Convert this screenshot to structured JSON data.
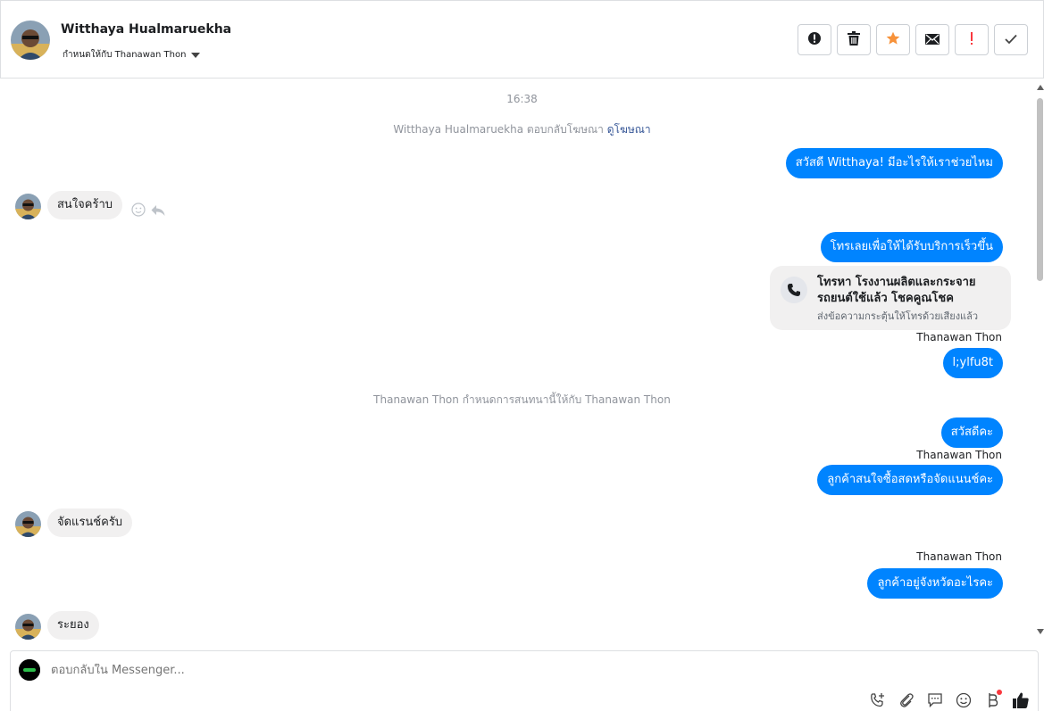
{
  "header": {
    "name": "Witthaya Hualmaruekha",
    "assigned_label": "กำหนดให้กับ Thanawan Thon",
    "actions": [
      "spam-icon",
      "trash-icon",
      "star-icon",
      "mark-unread-icon",
      "follow-up-icon",
      "done-icon"
    ],
    "star_color": "#f7923a",
    "followup_color": "#fa383e"
  },
  "chat": {
    "timestamp": "16:38",
    "ad_reply_text": "Witthaya Hualmaruekha ตอบกลับโฆษณา",
    "ad_reply_link": "ดูโฆษณา",
    "messages": {
      "m1": "สวัสดี Witthaya! มีอะไรให้เราช่วยไหม",
      "m2": "สนใจคร้าบ",
      "m3": "โทรเลยเพื่อให้ได้รับบริการเร็วขึ้น",
      "m5_sender": "Thanawan Thon",
      "m5": "l;ylfu8t",
      "m6_sender": "Thanawan Thon",
      "m7": "สวัสดีคะ",
      "m8_sender": "Thanawan Thon",
      "m8": "ลูกค้าสนใจซื้อสดหรือจัดแนนช์คะ",
      "m9": "จัดแรนช์ครับ",
      "m10_sender": "Thanawan Thon",
      "m10": "ลูกค้าอยู่จังหวัดอะไรคะ",
      "m11": "ระยอง"
    },
    "call_card": {
      "title": "โทรหา โรงงานผลิตและกระจายรถยนต์ใช้แล้ว โชคคูณโชค",
      "subtitle": "ส่งข้อความกระตุ้นให้โทรด้วยเสียงแล้ว"
    },
    "assign_note": "Thanawan Thon กำหนดการสนทนานี้ให้กับ Thanawan Thon",
    "outgoing_color": "#0084ff",
    "incoming_color": "#f1f0f0"
  },
  "composer": {
    "placeholder": "ตอบกลับใน Messenger...",
    "tools": [
      "call-add-icon",
      "attach-icon",
      "saved-reply-icon",
      "emoji-icon",
      "payment-icon",
      "like-icon"
    ]
  }
}
